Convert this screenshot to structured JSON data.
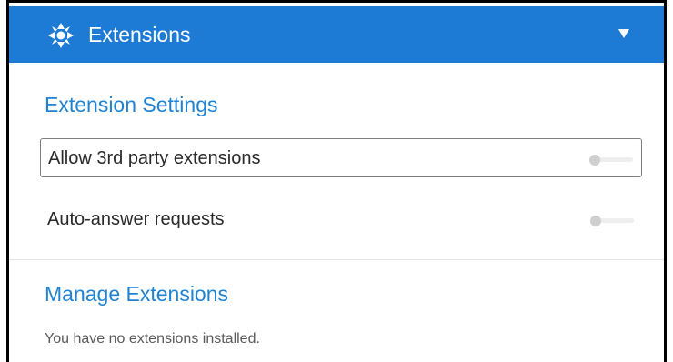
{
  "header": {
    "title": "Extensions",
    "logo_icon": "extensions-compass-icon",
    "collapse_icon": "triangle-down-icon"
  },
  "settings": {
    "title": "Extension Settings",
    "items": [
      {
        "label": "Allow 3rd party extensions",
        "enabled": false
      },
      {
        "label": "Auto-answer requests",
        "enabled": false
      }
    ]
  },
  "manage": {
    "title": "Manage Extensions",
    "empty_text": "You have no extensions installed."
  },
  "colors": {
    "header_bg": "#1d7bd6",
    "accent_text": "#1f83d1"
  }
}
